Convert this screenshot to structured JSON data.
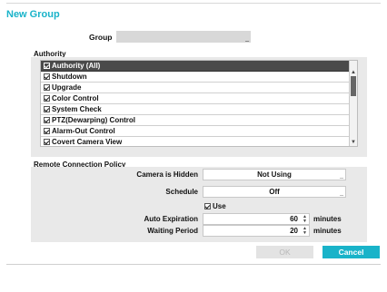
{
  "dialog": {
    "title": "New Group"
  },
  "group": {
    "label": "Group",
    "value": ""
  },
  "authority": {
    "label": "Authority",
    "items": [
      {
        "label": "Authority (All)",
        "checked": true
      },
      {
        "label": "Shutdown",
        "checked": true
      },
      {
        "label": "Upgrade",
        "checked": true
      },
      {
        "label": "Color Control",
        "checked": true
      },
      {
        "label": "System Check",
        "checked": true
      },
      {
        "label": "PTZ(Dewarping) Control",
        "checked": true
      },
      {
        "label": "Alarm-Out Control",
        "checked": true
      },
      {
        "label": "Covert Camera View",
        "checked": true
      }
    ]
  },
  "remote": {
    "label": "Remote Connection Policy",
    "camera_hidden": {
      "label": "Camera is Hidden",
      "value": "Not Using"
    },
    "schedule": {
      "label": "Schedule",
      "value": "Off"
    },
    "use": {
      "label": "Use",
      "checked": true
    },
    "auto_expiration": {
      "label": "Auto Expiration",
      "value": "60",
      "unit": "minutes"
    },
    "waiting_period": {
      "label": "Waiting Period",
      "value": "20",
      "unit": "minutes"
    }
  },
  "buttons": {
    "ok": "OK",
    "cancel": "Cancel"
  },
  "colors": {
    "accent": "#19b3c9",
    "selected_row": "#4a4a4a",
    "panel": "#e9e9e9"
  }
}
